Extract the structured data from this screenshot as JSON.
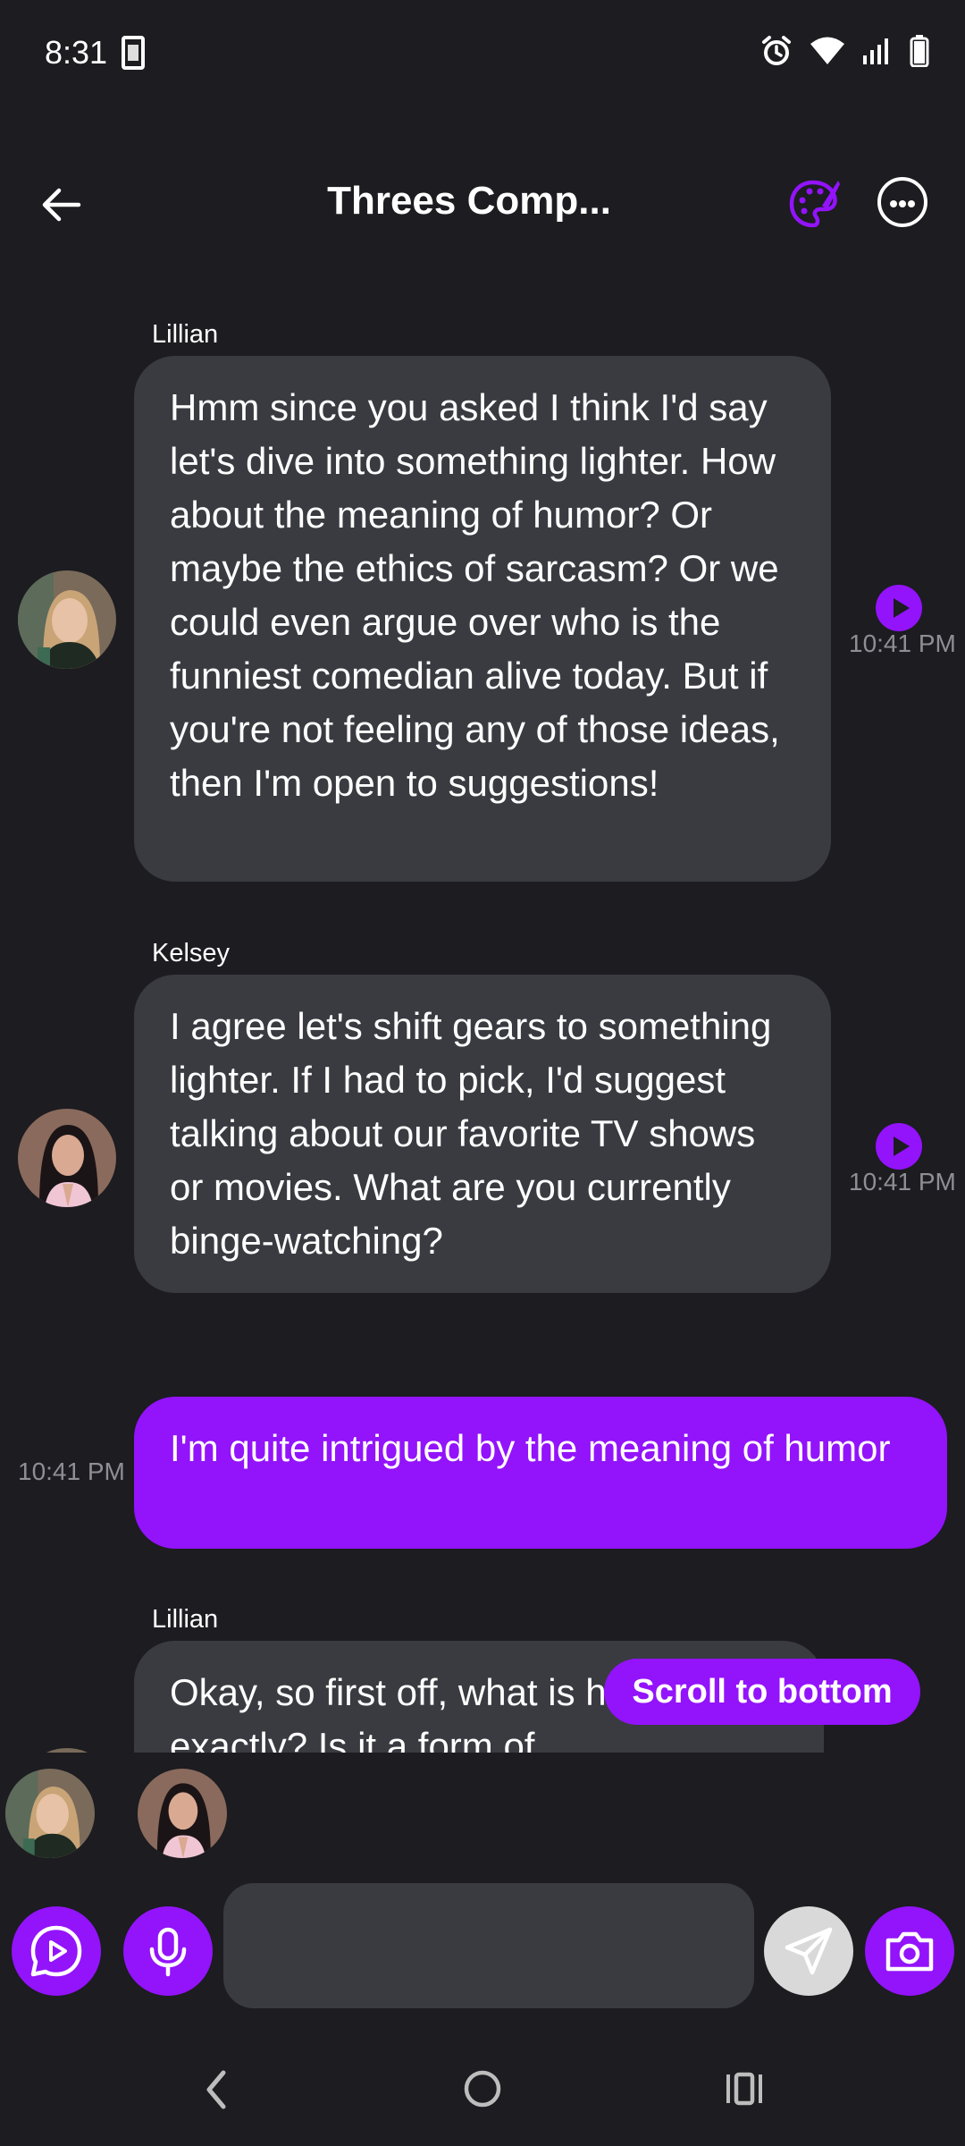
{
  "status_bar": {
    "time": "8:31"
  },
  "header": {
    "title": "Threes Comp..."
  },
  "messages": [
    {
      "sender": "Lillian",
      "text": "Hmm since you asked I think I'd say let's dive into something lighter. How about the meaning of humor? Or maybe the ethics of sarcasm? Or we could even argue over who is the funniest comedian alive today. But if you're not feeling any of those ideas, then I'm open to suggestions!",
      "time": "10:41 PM"
    },
    {
      "sender": "Kelsey",
      "text": "I agree let's shift gears to something lighter. If I had to pick, I'd suggest talking about our favorite TV shows or movies. What are you currently binge-watching?",
      "time": "10:41 PM"
    },
    {
      "sender": "",
      "text": "I'm quite intrigued by the meaning of humor",
      "time": "10:41 PM"
    },
    {
      "sender": "Lillian",
      "text": "Okay, so first off, what is humor exactly? Is it a form of",
      "time": ""
    }
  ],
  "scroll_to_bottom_label": "Scroll to bottom",
  "composer": {
    "placeholder": ""
  },
  "colors": {
    "accent": "#9313fb",
    "background": "#1c1c21",
    "bubble": "#3a3b41"
  }
}
